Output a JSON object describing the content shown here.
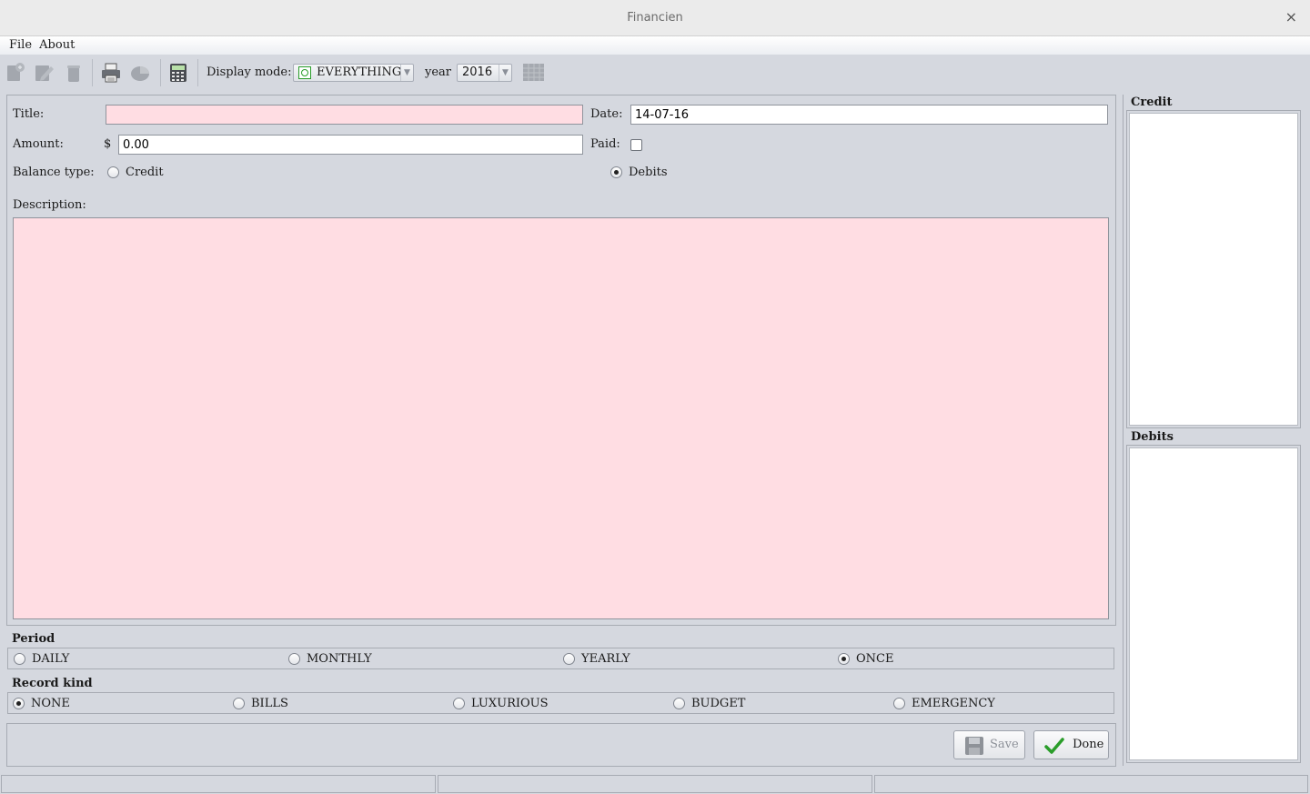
{
  "window": {
    "title": "Financien",
    "close_glyph": "×"
  },
  "menu": {
    "items": [
      "File",
      "About"
    ]
  },
  "toolbar": {
    "display_mode_label": "Display mode:",
    "display_mode_value": "EVERYTHING",
    "year_label": "year",
    "year_value": "2016",
    "icons": [
      "new-record-icon",
      "edit-record-icon",
      "delete-record-icon",
      "print-icon",
      "chart-icon",
      "calculator-icon",
      "calendar-icon"
    ]
  },
  "form": {
    "title_label": "Title:",
    "title_value": "",
    "date_label": "Date:",
    "date_value": "14-07-16",
    "amount_label": "Amount:",
    "currency_symbol": "$",
    "amount_value": "0.00",
    "paid_label": "Paid:",
    "paid_checked": false,
    "balance_type_label": "Balance type:",
    "balance_options": [
      "Credit",
      "Debits"
    ],
    "balance_selected": "Debits",
    "description_label": "Description:",
    "description_value": ""
  },
  "period": {
    "title": "Period",
    "options": [
      "DAILY",
      "MONTHLY",
      "YEARLY",
      "ONCE"
    ],
    "selected": "ONCE"
  },
  "record_kind": {
    "title": "Record kind",
    "options": [
      "NONE",
      "BILLS",
      "LUXURIOUS",
      "BUDGET",
      "EMERGENCY"
    ],
    "selected": "NONE"
  },
  "buttons": {
    "save": "Save",
    "done": "Done"
  },
  "side": {
    "credit_title": "Credit",
    "debits_title": "Debits"
  },
  "colors": {
    "invalid_field": "#ffdde3",
    "background": "#d5d8df",
    "accent_green": "#2a9d2a"
  }
}
